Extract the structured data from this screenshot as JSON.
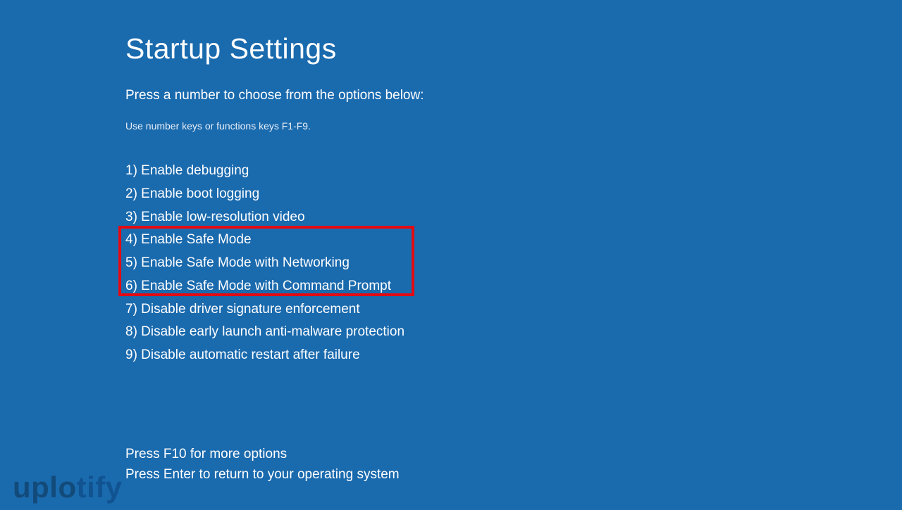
{
  "title": "Startup Settings",
  "instruction": "Press a number to choose from the options below:",
  "hint": "Use number keys or functions keys F1-F9.",
  "options": [
    "1) Enable debugging",
    "2) Enable boot logging",
    "3) Enable low-resolution video",
    "4) Enable Safe Mode",
    "5) Enable Safe Mode with Networking",
    "6) Enable Safe Mode with Command Prompt",
    "7) Disable driver signature enforcement",
    "8) Disable early launch anti-malware protection",
    "9) Disable automatic restart after failure"
  ],
  "footer": {
    "more": "Press F10 for more options",
    "return": "Press Enter to return to your operating system"
  },
  "watermark": {
    "part1": "uplo",
    "part2": "tify"
  }
}
